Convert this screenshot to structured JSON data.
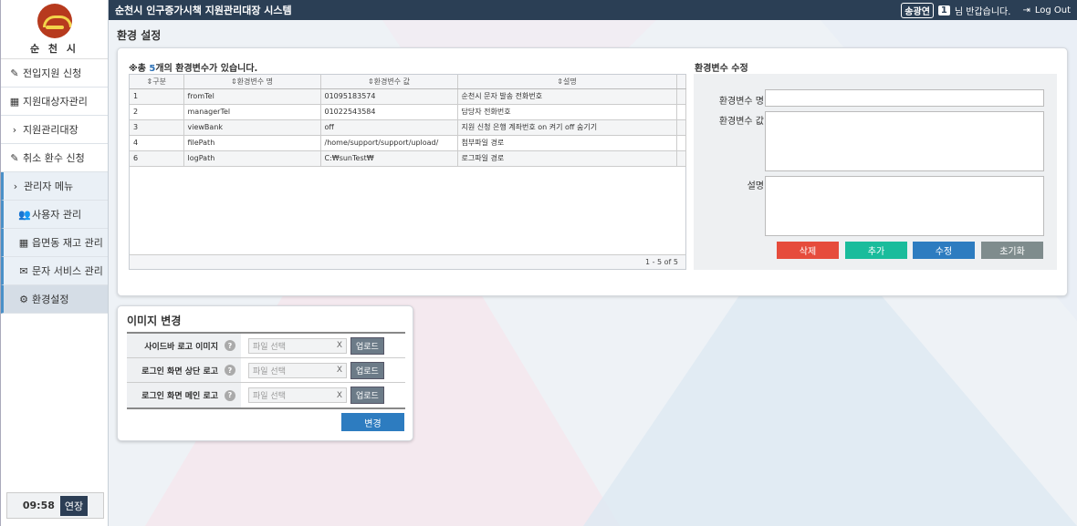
{
  "app": {
    "title": "순천시 인구증가시책 지원관리대장 시스템",
    "logo_text": "순 천 시"
  },
  "header": {
    "user_badge": "송광연",
    "count_badge": "1",
    "greeting": "님 반갑습니다.",
    "logout": "Log Out"
  },
  "sidebar": {
    "items": [
      {
        "label": "전입지원 신청",
        "icon": "form-icon"
      },
      {
        "label": "지원대상자관리",
        "icon": "table-icon"
      },
      {
        "label": "지원관리대장",
        "icon": "chevron-right-icon"
      },
      {
        "label": "취소 환수 신청",
        "icon": "form-icon"
      },
      {
        "label": "관리자 메뉴",
        "icon": "chevron-right-icon"
      },
      {
        "label": "사용자 관리",
        "icon": "users-icon"
      },
      {
        "label": "읍면동 재고 관리",
        "icon": "table-icon"
      },
      {
        "label": "문자 서비스 관리",
        "icon": "mail-icon"
      },
      {
        "label": "환경설정",
        "icon": "gear-icon"
      }
    ],
    "timer": "09:58",
    "extend": "연장"
  },
  "page_title": "환경 설정",
  "env": {
    "count_prefix": "※총 ",
    "count_num": "5",
    "count_suffix": "개의 환경변수가 있습니다.",
    "columns": [
      "구분",
      "환경변수 명",
      "환경변수 값",
      "설명"
    ],
    "rows": [
      [
        "1",
        "fromTel",
        "01095183574",
        "순천시 문자 발송 전화번호"
      ],
      [
        "2",
        "managerTel",
        "01022543584",
        "담당자 전화번호"
      ],
      [
        "3",
        "viewBank",
        "off",
        "지원 신청 은행 계좌번호 on 켜기 off 숨기기"
      ],
      [
        "4",
        "filePath",
        "/home/support/support/upload/",
        "첨부파일 경로"
      ],
      [
        "6",
        "logPath",
        "C:₩sunTest₩",
        "로그파일 경로"
      ]
    ],
    "pager": "1 - 5 of 5"
  },
  "edit": {
    "title": "환경변수 수정",
    "name_label": "환경변수 명",
    "value_label": "환경변수 값",
    "desc_label": "설명",
    "buttons": {
      "delete": "삭제",
      "add": "추가",
      "update": "수정",
      "reset": "초기화"
    }
  },
  "image_change": {
    "title": "이미지 변경",
    "rows": [
      {
        "label": "사이드바 로고 이미지"
      },
      {
        "label": "로그인 화면 상단 로고"
      },
      {
        "label": "로그인 화면 메인 로고"
      }
    ],
    "placeholder": "파일 선택",
    "clear": "X",
    "upload": "업로드",
    "submit": "변경"
  },
  "colors": {
    "header_bg": "#2b3f55",
    "delete": "#e64c3c",
    "add": "#1abc9c",
    "update": "#2d7cc0",
    "reset": "#7f8c8d"
  }
}
